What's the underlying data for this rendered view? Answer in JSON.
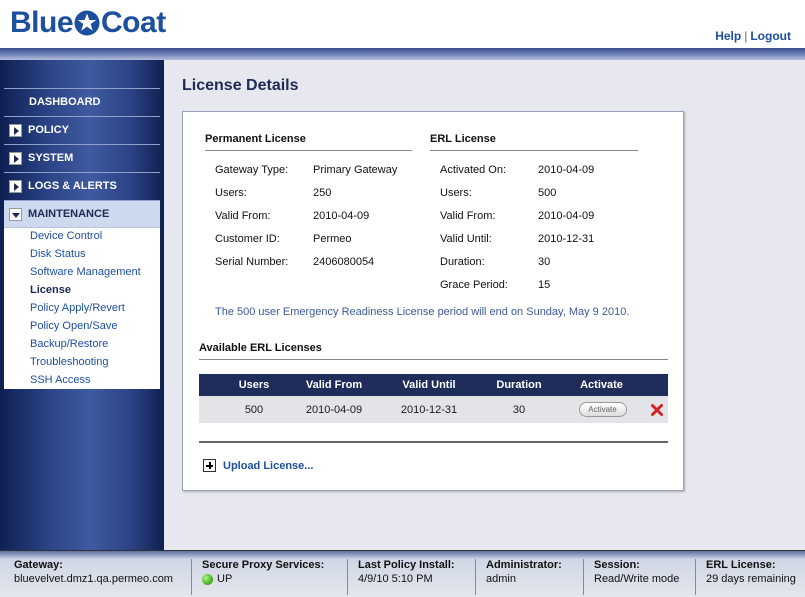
{
  "header": {
    "logo_text_left": "Blue",
    "logo_text_right": "Coat",
    "help_label": "Help",
    "separator": "|",
    "logout_label": "Logout"
  },
  "sidebar": {
    "items": [
      {
        "label": "DASHBOARD"
      },
      {
        "label": "POLICY"
      },
      {
        "label": "SYSTEM"
      },
      {
        "label": "LOGS & ALERTS"
      },
      {
        "label": "MAINTENANCE"
      }
    ],
    "subitems": [
      {
        "label": "Device Control"
      },
      {
        "label": "Disk Status"
      },
      {
        "label": "Software Management"
      },
      {
        "label": "License"
      },
      {
        "label": "Policy Apply/Revert"
      },
      {
        "label": "Policy Open/Save"
      },
      {
        "label": "Backup/Restore"
      },
      {
        "label": "Troubleshooting"
      },
      {
        "label": "SSH Access"
      }
    ]
  },
  "main": {
    "title": "License Details",
    "permanent": {
      "title": "Permanent License",
      "rows": [
        {
          "label": "Gateway Type:",
          "value": "Primary Gateway"
        },
        {
          "label": "Users:",
          "value": "250"
        },
        {
          "label": "Valid From:",
          "value": "2010-04-09"
        },
        {
          "label": "Customer ID:",
          "value": "Permeo"
        },
        {
          "label": "Serial Number:",
          "value": "2406080054"
        }
      ]
    },
    "erl": {
      "title": "ERL License",
      "rows": [
        {
          "label": "Activated On:",
          "value": "2010-04-09"
        },
        {
          "label": "Users:",
          "value": "500"
        },
        {
          "label": "Valid From:",
          "value": "2010-04-09"
        },
        {
          "label": "Valid Until:",
          "value": "2010-12-31"
        },
        {
          "label": "Duration:",
          "value": "30"
        },
        {
          "label": "Grace Period:",
          "value": "15"
        }
      ]
    },
    "notice": "The 500 user Emergency Readiness License period will end on Sunday, May 9 2010.",
    "available": {
      "title": "Available ERL Licenses",
      "columns": [
        "Users",
        "Valid From",
        "Valid Until",
        "Duration",
        "Activate"
      ],
      "rows": [
        {
          "users": "500",
          "valid_from": "2010-04-09",
          "valid_until": "2010-12-31",
          "duration": "30",
          "activate_label": "Activate"
        }
      ]
    },
    "upload_label": "Upload License..."
  },
  "statusbar": {
    "gateway": {
      "label": "Gateway:",
      "value": "bluevelvet.dmz1.qa.permeo.com"
    },
    "proxy": {
      "label": "Secure Proxy Services:",
      "value": "UP"
    },
    "policy": {
      "label": "Last Policy Install:",
      "value": "4/9/10 5:10 PM"
    },
    "admin": {
      "label": "Administrator:",
      "value": "admin"
    },
    "session": {
      "label": "Session:",
      "value": "Read/Write mode"
    },
    "erl": {
      "label": "ERL License:",
      "value": "29 days remaining"
    }
  },
  "colors": {
    "brand": "#1d4f9f",
    "nav_dark": "#1f2d5a",
    "status_up": "#3aa616",
    "delete": "#d22222"
  }
}
